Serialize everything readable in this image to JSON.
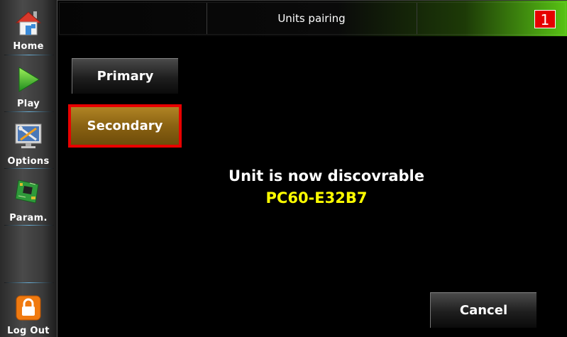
{
  "sidebar": {
    "items": [
      {
        "label": "Home",
        "icon": "home-icon"
      },
      {
        "label": "Play",
        "icon": "play-icon"
      },
      {
        "label": "Options",
        "icon": "tools-monitor-icon"
      },
      {
        "label": "Param.",
        "icon": "circuit-board-icon"
      }
    ],
    "logout": {
      "label": "Log Out",
      "icon": "lock-icon"
    }
  },
  "header": {
    "title": "Units pairing",
    "badge": "1",
    "badge_color": "#e60000"
  },
  "buttons": {
    "primary": "Primary",
    "secondary": "Secondary",
    "cancel": "Cancel"
  },
  "message": {
    "status": "Unit is now discovrable",
    "unit_id": "PC60-E32B7",
    "unit_id_color": "#ffff00"
  },
  "colors": {
    "selected_button": "#8a6212",
    "selection_border": "#e80000",
    "header_accent": "#58c414"
  }
}
